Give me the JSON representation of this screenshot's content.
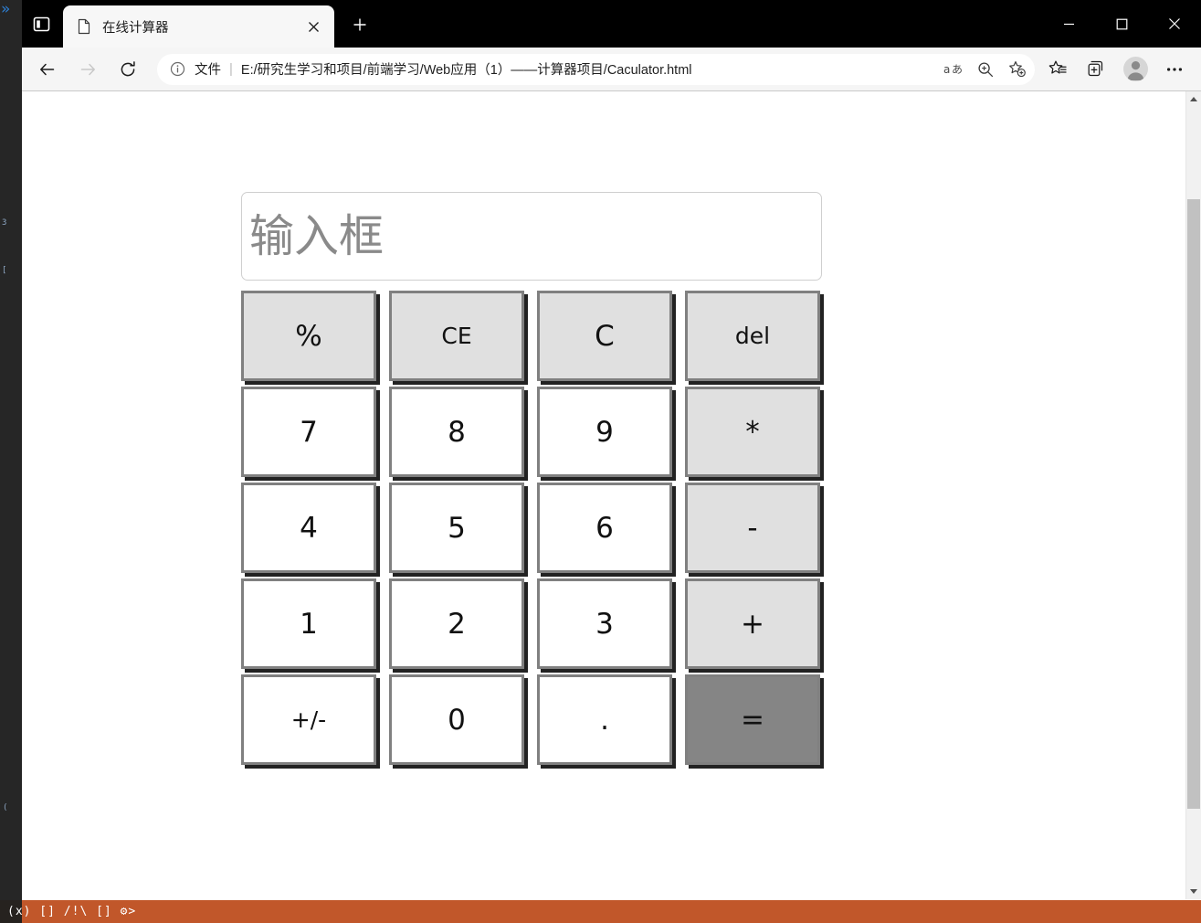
{
  "window": {
    "controls": {
      "minimize": "—",
      "maximize": "□",
      "close": "✕"
    }
  },
  "tabstrip": {
    "tab_search_icon": "tab-actions-icon",
    "new_tab_label": "+",
    "tabs": [
      {
        "title": "在线计算器",
        "favicon": "page-icon",
        "close_label": "✕",
        "active": true
      }
    ]
  },
  "toolbar": {
    "back_label": "←",
    "forward_label": "→",
    "reload_label": "↻",
    "info_icon": "info-circle-icon",
    "scheme_label": "文件",
    "separator": "|",
    "url": "E:/研究生学习和项目/前端学习/Web应用（1）——计算器项目/Caculator.html",
    "translate_label": "aあ",
    "zoom_icon": "magnifier-plus-icon",
    "add_favorite_icon": "star-plus-icon",
    "favorites_icon": "favorites-list-icon",
    "collections_icon": "collections-icon",
    "profile_icon": "profile-avatar-icon",
    "more_label": "⋯"
  },
  "page": {
    "display": {
      "placeholder": "输入框",
      "value": ""
    },
    "keypad": [
      {
        "label": "%",
        "type": "func",
        "name": "key-percent"
      },
      {
        "label": "CE",
        "type": "func",
        "name": "key-clear-entry"
      },
      {
        "label": "C",
        "type": "func",
        "name": "key-clear"
      },
      {
        "label": "del",
        "type": "func",
        "name": "key-delete"
      },
      {
        "label": "7",
        "type": "digit",
        "name": "key-7"
      },
      {
        "label": "8",
        "type": "digit",
        "name": "key-8"
      },
      {
        "label": "9",
        "type": "digit",
        "name": "key-9"
      },
      {
        "label": "*",
        "type": "op",
        "name": "key-multiply"
      },
      {
        "label": "4",
        "type": "digit",
        "name": "key-4"
      },
      {
        "label": "5",
        "type": "digit",
        "name": "key-5"
      },
      {
        "label": "6",
        "type": "digit",
        "name": "key-6"
      },
      {
        "label": "-",
        "type": "op",
        "name": "key-subtract"
      },
      {
        "label": "1",
        "type": "digit",
        "name": "key-1"
      },
      {
        "label": "2",
        "type": "digit",
        "name": "key-2"
      },
      {
        "label": "3",
        "type": "digit",
        "name": "key-3"
      },
      {
        "label": "+",
        "type": "op",
        "name": "key-add"
      },
      {
        "label": "+/-",
        "type": "digit",
        "name": "key-sign-toggle"
      },
      {
        "label": "0",
        "type": "digit",
        "name": "key-0"
      },
      {
        "label": ".",
        "type": "digit",
        "name": "key-decimal"
      },
      {
        "label": "=",
        "type": "equals",
        "name": "key-equals"
      }
    ]
  },
  "scrollbar": {
    "up_label": "▲",
    "down_label": "▼"
  },
  "desktop": {
    "chevron": "»",
    "taskbar_glyphs": "(x) [] /!\\ []   ⚙>"
  },
  "colors": {
    "titlebar": "#000000",
    "toolbar": "#f5f5f5",
    "key_face": "#ffffff",
    "key_func": "#e0e0e0",
    "key_equals": "#858585",
    "key_border": "#808080",
    "key_shadow": "#222222",
    "placeholder": "#8a8a8a",
    "taskbar": "#c1572a"
  }
}
